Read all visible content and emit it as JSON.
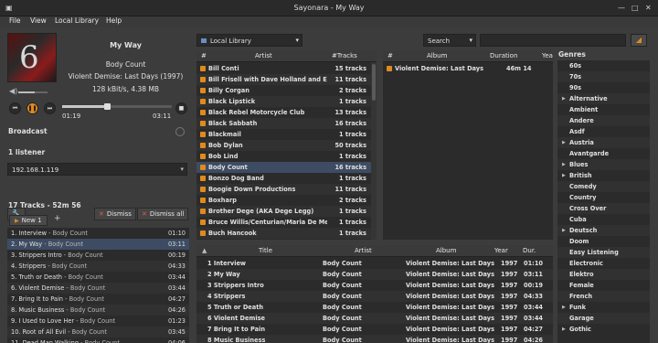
{
  "window": {
    "title": "Sayonara - My Way"
  },
  "menu": {
    "file": "File",
    "view": "View",
    "library": "Local Library",
    "help": "Help"
  },
  "now_playing": {
    "title": "My Way",
    "artist": "Body Count",
    "album": "Violent Demise: Last Days (1997)",
    "info": "128 kBit/s, 4.38 MB",
    "elapsed": "01:19",
    "total": "03:11",
    "progress": 0.41,
    "volume": 0.55
  },
  "broadcast": {
    "label": "Broadcast",
    "listeners": "1 listener",
    "ip": "192.168.1.119",
    "dismiss": "Dismiss",
    "dismiss_all": "Dismiss all"
  },
  "playlist": {
    "summary": "17 Tracks - 52m 56",
    "tab": "New 1",
    "add": "+",
    "items": [
      {
        "title": "1. Interview",
        "artist": "Body Count",
        "dur": "01:10"
      },
      {
        "title": "2. My Way",
        "artist": "Body Count",
        "dur": "03:11",
        "selected": true
      },
      {
        "title": "3. Strippers Intro",
        "artist": "Body Count",
        "dur": "00:19"
      },
      {
        "title": "4. Strippers",
        "artist": "Body Count",
        "dur": "04:33"
      },
      {
        "title": "5. Truth or Death",
        "artist": "Body Count",
        "dur": "03:44"
      },
      {
        "title": "6. Violent Demise",
        "artist": "Body Count",
        "dur": "03:44"
      },
      {
        "title": "7. Bring It to Pain",
        "artist": "Body Count",
        "dur": "04:27"
      },
      {
        "title": "8. Music Business",
        "artist": "Body Count",
        "dur": "04:26"
      },
      {
        "title": "9. I Used to Love Her",
        "artist": "Body Count",
        "dur": "01:23"
      },
      {
        "title": "10. Root of All Evil",
        "artist": "Body Count",
        "dur": "03:45"
      },
      {
        "title": "11. Dead Man Walking",
        "artist": "Body Count",
        "dur": "04:06"
      }
    ]
  },
  "library": {
    "source": "Local Library",
    "search_mode": "Search",
    "search_value": "",
    "artists_header": {
      "hash": "#",
      "artist": "Artist",
      "tracks": "#Tracks"
    },
    "artists": [
      {
        "name": "Bill Conti",
        "tracks": "15 tracks"
      },
      {
        "name": "Bill Frisell with Dave Holland and Elvin Jo",
        "tracks": "11 tracks"
      },
      {
        "name": "Billy Corgan",
        "tracks": "2 tracks"
      },
      {
        "name": "Black Lipstick",
        "tracks": "1 tracks"
      },
      {
        "name": "Black Rebel Motorcycle Club",
        "tracks": "13 tracks"
      },
      {
        "name": "Black Sabbath",
        "tracks": "16 tracks"
      },
      {
        "name": "Blackmail",
        "tracks": "1 tracks"
      },
      {
        "name": "Bob Dylan",
        "tracks": "50 tracks"
      },
      {
        "name": "Bob Lind",
        "tracks": "1 tracks"
      },
      {
        "name": "Body Count",
        "tracks": "16 tracks",
        "selected": true
      },
      {
        "name": "Bonzo Dog Band",
        "tracks": "1 tracks"
      },
      {
        "name": "Boogie Down Productions",
        "tracks": "11 tracks"
      },
      {
        "name": "Boxharp",
        "tracks": "2 tracks"
      },
      {
        "name": "Brother Dege (AKA Dege Legg)",
        "tracks": "1 tracks"
      },
      {
        "name": "Bruce Willis/Centurian/Maria De Medeiros",
        "tracks": "1 tracks"
      },
      {
        "name": "Buch Hancook",
        "tracks": "1 tracks"
      }
    ],
    "albums_header": {
      "hash": "#",
      "album": "Album",
      "duration": "Duration",
      "year": "Yea"
    },
    "albums": [
      {
        "name": "Violent Demise: Last Days",
        "duration": "46m 14"
      }
    ],
    "tracks_header": {
      "title": "Title",
      "artist": "Artist",
      "album": "Album",
      "year": "Year",
      "dur": "Dur."
    },
    "tracks": [
      {
        "title": "1 Interview",
        "artist": "Body Count",
        "album": "Violent Demise: Last Days",
        "year": "1997",
        "dur": "01:10"
      },
      {
        "title": "2 My Way",
        "artist": "Body Count",
        "album": "Violent Demise: Last Days",
        "year": "1997",
        "dur": "03:11"
      },
      {
        "title": "3 Strippers Intro",
        "artist": "Body Count",
        "album": "Violent Demise: Last Days",
        "year": "1997",
        "dur": "00:19"
      },
      {
        "title": "4 Strippers",
        "artist": "Body Count",
        "album": "Violent Demise: Last Days",
        "year": "1997",
        "dur": "04:33"
      },
      {
        "title": "5 Truth or Death",
        "artist": "Body Count",
        "album": "Violent Demise: Last Days",
        "year": "1997",
        "dur": "03:44"
      },
      {
        "title": "6 Violent Demise",
        "artist": "Body Count",
        "album": "Violent Demise: Last Days",
        "year": "1997",
        "dur": "03:44"
      },
      {
        "title": "7 Bring It to Pain",
        "artist": "Body Count",
        "album": "Violent Demise: Last Days",
        "year": "1997",
        "dur": "04:27"
      },
      {
        "title": "8 Music Business",
        "artist": "Body Count",
        "album": "Violent Demise: Last Days",
        "year": "1997",
        "dur": "04:26"
      }
    ]
  },
  "genres": {
    "title": "Genres",
    "items": [
      {
        "name": "60s"
      },
      {
        "name": "70s"
      },
      {
        "name": "90s"
      },
      {
        "name": "Alternative",
        "expandable": true
      },
      {
        "name": "Ambient"
      },
      {
        "name": "Andere"
      },
      {
        "name": "Asdf"
      },
      {
        "name": "Austria",
        "expandable": true
      },
      {
        "name": "Avantgarde"
      },
      {
        "name": "Blues",
        "expandable": true
      },
      {
        "name": "British",
        "expandable": true
      },
      {
        "name": "Comedy"
      },
      {
        "name": "Country"
      },
      {
        "name": "Cross Over"
      },
      {
        "name": "Cuba"
      },
      {
        "name": "Deutsch",
        "expandable": true
      },
      {
        "name": "Doom"
      },
      {
        "name": "Easy Listening"
      },
      {
        "name": "Electronic"
      },
      {
        "name": "Elektro"
      },
      {
        "name": "Female"
      },
      {
        "name": "French"
      },
      {
        "name": "Funk",
        "expandable": true
      },
      {
        "name": "Garage"
      },
      {
        "name": "Gothic",
        "expandable": true
      }
    ]
  },
  "colors": {
    "accent": "#e08a1e",
    "selection": "#3d4c63",
    "list_bg": "#2b2b2b",
    "window_bg": "#3c3c3c"
  }
}
